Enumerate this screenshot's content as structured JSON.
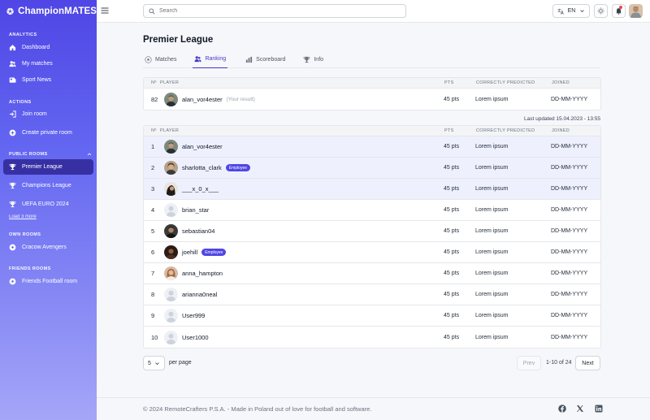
{
  "app": {
    "brand": "ChampionMATES"
  },
  "sidebar": {
    "sections": [
      {
        "title": "ANALYTICS",
        "items": [
          "Dashboard",
          "My matches",
          "Sport News"
        ]
      },
      {
        "title": "ACTIONS",
        "items": [
          "Join room",
          "Create private room"
        ]
      },
      {
        "title": "PUBLIC ROOMS",
        "items": [
          "Premier League",
          "Champions League",
          "UEFA EURO 2024"
        ],
        "load_more": "Load 3 more"
      },
      {
        "title": "OWN ROOMS",
        "items": [
          "Cracow Avengers"
        ]
      },
      {
        "title": "FRIENDS ROOMS",
        "items": [
          "Friends Football room"
        ]
      }
    ]
  },
  "topbar": {
    "search_placeholder": "Search",
    "language": "EN"
  },
  "page": {
    "title": "Premier League",
    "tabs": [
      "Matches",
      "Ranking",
      "Scoreboard",
      "Info"
    ],
    "active_tab": "Ranking"
  },
  "columns": {
    "no": "Nº",
    "player": "PLAYER",
    "pts": "PTS",
    "predicted": "CORRECTLY PREDICTED",
    "joined": "JOINED"
  },
  "my_result": {
    "no": "82",
    "player": "alan_vor4ester",
    "note": "(Your result)",
    "pts": "45 pts",
    "predicted": "Lorem ipsum",
    "joined": "DD-MM-YYYY"
  },
  "last_updated": "Last updated 15.04.2023 - 13:55",
  "ranking": [
    {
      "no": "1",
      "player": "alan_vor4ester",
      "badge": "",
      "pts": "45 pts",
      "predicted": "Lorem ipsum",
      "joined": "DD-MM-YYYY"
    },
    {
      "no": "2",
      "player": "sharlotta_clark",
      "badge": "Employee",
      "pts": "45 pts",
      "predicted": "Lorem ipsum",
      "joined": "DD-MM-YYYY"
    },
    {
      "no": "3",
      "player": "___x_0_x___",
      "badge": "",
      "pts": "45 pts",
      "predicted": "Lorem ipsum",
      "joined": "DD-MM-YYYY"
    },
    {
      "no": "4",
      "player": "brian_star",
      "badge": "",
      "pts": "45 pts",
      "predicted": "Lorem ipsum",
      "joined": "DD-MM-YYYY"
    },
    {
      "no": "5",
      "player": "sebastian04",
      "badge": "",
      "pts": "45 pts",
      "predicted": "Lorem ipsum",
      "joined": "DD-MM-YYYY"
    },
    {
      "no": "6",
      "player": "joehill",
      "badge": "Employee",
      "pts": "45 pts",
      "predicted": "Lorem ipsum",
      "joined": "DD-MM-YYYY"
    },
    {
      "no": "7",
      "player": "anna_hampton",
      "badge": "",
      "pts": "45 pts",
      "predicted": "Lorem ipsum",
      "joined": "DD-MM-YYYY"
    },
    {
      "no": "8",
      "player": "arianna0neal",
      "badge": "",
      "pts": "45 pts",
      "predicted": "Lorem ipsum",
      "joined": "DD-MM-YYYY"
    },
    {
      "no": "9",
      "player": "User999",
      "badge": "",
      "pts": "45 pts",
      "predicted": "Lorem ipsum",
      "joined": "DD-MM-YYYY"
    },
    {
      "no": "10",
      "player": "User1000",
      "badge": "",
      "pts": "45 pts",
      "predicted": "Lorem ipsum",
      "joined": "DD-MM-YYYY"
    }
  ],
  "pagination": {
    "per_page_value": "5",
    "per_page_label": "per page",
    "prev": "Prev",
    "range": "1-10 of 24",
    "next": "Next"
  },
  "footer": {
    "copyright": "© 2024 RemoteCrafters P.S.A. - Made in Poland out of love for football and software."
  },
  "colors": {
    "accent": "#4f46e5",
    "highlight_row": "#eef0fd",
    "badge": "#4f46e5"
  }
}
